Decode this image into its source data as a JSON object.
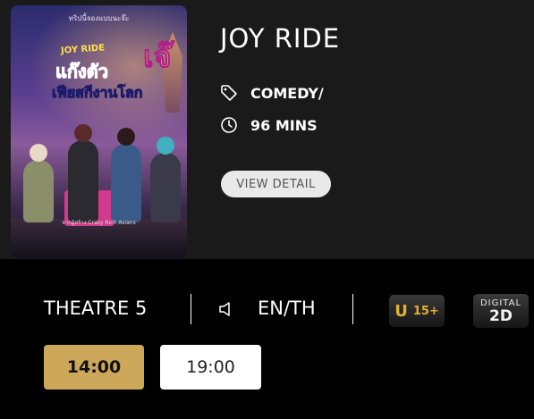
{
  "movie": {
    "title": "JOY RIDE",
    "genre": "COMEDY/",
    "duration": "96 MINS",
    "detail_button": "VIEW DETAIL",
    "poster": {
      "tagline": "ทริปนี้จองแบบนะจ๊ะ",
      "logo_en": "JOY RIDE",
      "logo_th_1": "แก๊งตัว",
      "logo_th_2": "เจ๊",
      "logo_th_3": "เฟียสกีงานโลก",
      "credit": "จากผู้สร้าง Crazy Rich Asians"
    }
  },
  "session": {
    "theatre": "THEATRE 5",
    "language": "EN/TH",
    "rating_letter": "U",
    "rating_age": "15+",
    "format_line1": "DIGITAL",
    "format_line2": "2D"
  },
  "showtimes": [
    {
      "time": "14:00",
      "selected": true
    },
    {
      "time": "19:00",
      "selected": false
    }
  ],
  "icons": {
    "genre": "tag-icon",
    "duration": "clock-icon",
    "audio": "speaker-icon"
  },
  "colors": {
    "selected_time": "#cda85a",
    "rating_text": "#e3b033",
    "card_bg": "#1a1a1a"
  }
}
